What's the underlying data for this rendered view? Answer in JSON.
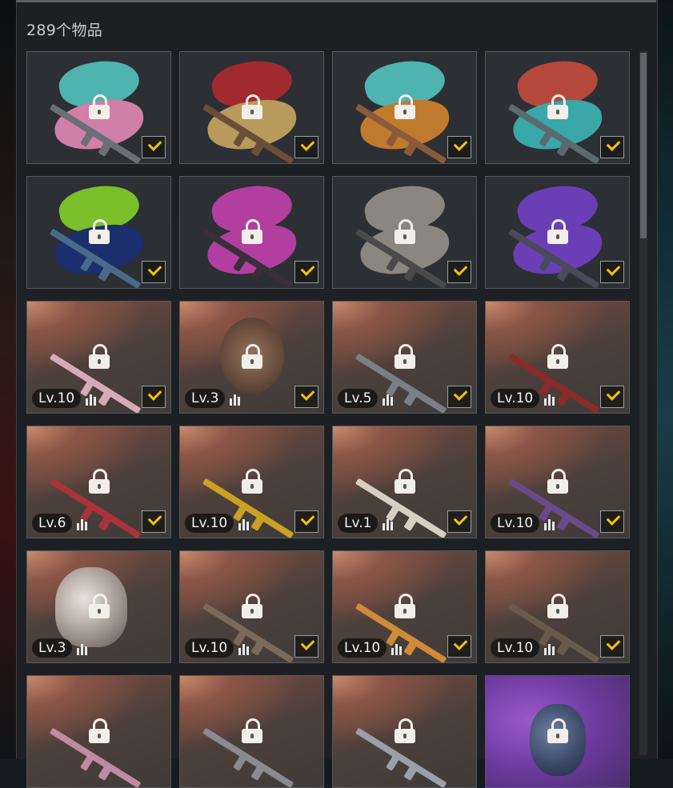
{
  "header": {
    "item_count": "289个物品"
  },
  "colors": {
    "check_accent": "#f5c400",
    "panel_bg": "#1e2124"
  },
  "rows": [
    [
      {
        "type": "plain",
        "splat1": "#4fb3b0",
        "splat2": "#d07fa8",
        "weapon": "#6b6f75",
        "level": "",
        "check": true
      },
      {
        "type": "plain",
        "splat1": "#a12a2e",
        "splat2": "#b89a5c",
        "weapon": "#6b4d3a",
        "level": "",
        "check": true
      },
      {
        "type": "plain",
        "splat1": "#4fb3b0",
        "splat2": "#c07a2e",
        "weapon": "#8a5a3a",
        "level": "",
        "check": true
      },
      {
        "type": "plain",
        "splat1": "#b5483b",
        "splat2": "#3aa7a8",
        "weapon": "#5a6b70",
        "level": "",
        "check": true
      }
    ],
    [
      {
        "type": "plain",
        "splat1": "#7bbf2a",
        "splat2": "#1a2f6b",
        "weapon": "#4a6a8a",
        "level": "",
        "check": true
      },
      {
        "type": "plain",
        "splat1": "#b23fa0",
        "splat2": "#b23fa0",
        "weapon": "#3a2e3a",
        "level": "",
        "check": true
      },
      {
        "type": "plain",
        "splat1": "#8a8680",
        "splat2": "#8a8680",
        "weapon": "#4a4a4a",
        "level": "",
        "check": true
      },
      {
        "type": "plain",
        "splat1": "#6a3fb5",
        "splat2": "#6a3fb5",
        "weapon": "#4a4a5a",
        "level": "",
        "check": true
      }
    ],
    [
      {
        "type": "rarity",
        "art": "weapon",
        "weapon": "#d8a9b8",
        "level": "Lv.10",
        "check": true
      },
      {
        "type": "rarity",
        "art": "medal",
        "level": "Lv.3",
        "check": true
      },
      {
        "type": "rarity",
        "art": "weapon",
        "weapon": "#7a7f86",
        "level": "Lv.5",
        "check": true
      },
      {
        "type": "rarity",
        "art": "weapon",
        "weapon": "#8a2a2a",
        "level": "Lv.10",
        "check": true
      }
    ],
    [
      {
        "type": "rarity",
        "art": "weapon",
        "weapon": "#a8333a",
        "level": "Lv.6",
        "check": true
      },
      {
        "type": "rarity",
        "art": "weapon",
        "weapon": "#c9a224",
        "level": "Lv.10",
        "check": true
      },
      {
        "type": "rarity",
        "art": "weapon",
        "weapon": "#d8cfc2",
        "level": "Lv.1",
        "check": true
      },
      {
        "type": "rarity",
        "art": "weapon",
        "weapon": "#6a4a8a",
        "level": "Lv.10",
        "check": true
      }
    ],
    [
      {
        "type": "rarity",
        "art": "mask",
        "level": "Lv.3",
        "check": false
      },
      {
        "type": "rarity",
        "art": "weapon",
        "weapon": "#7a6a5a",
        "level": "Lv.10",
        "check": true
      },
      {
        "type": "rarity",
        "art": "weapon",
        "weapon": "#d08a3a",
        "level": "Lv.10",
        "check": true
      },
      {
        "type": "rarity",
        "art": "weapon",
        "weapon": "#6a5a4a",
        "level": "Lv.10",
        "check": true
      }
    ],
    [
      {
        "type": "rarity",
        "art": "weapon",
        "weapon": "#c08aa0",
        "level": "",
        "check": false
      },
      {
        "type": "rarity",
        "art": "weapon",
        "weapon": "#8a8a90",
        "level": "",
        "check": false
      },
      {
        "type": "rarity",
        "art": "weapon",
        "weapon": "#9aa0aa",
        "level": "",
        "check": false
      },
      {
        "type": "purple",
        "art": "grenade",
        "level": "",
        "check": false
      }
    ]
  ]
}
